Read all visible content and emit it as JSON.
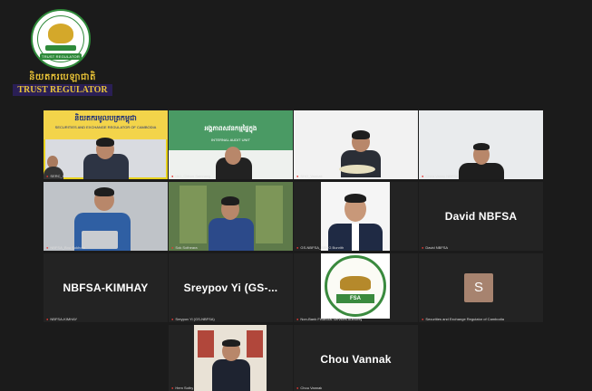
{
  "logo": {
    "khmer_text": "និយតករបេឡាជាតិ",
    "english_text": "TRUST REGULATOR",
    "ribbon_text": "TRUST REGULATOR"
  },
  "colors": {
    "background": "#1b1b1b",
    "active_speaker": "#e8d21d",
    "muted_mic": "#e53935",
    "brand_gold": "#e7c23a",
    "brand_green": "#2f8a3a"
  },
  "tiles": [
    {
      "name": "SERC_Ho Lisa",
      "banner_kh": "និយតករមូលបត្រកម្ពុជា",
      "banner_en": "SECURITIES AND EXCHANGE REGULATOR OF CAMBODIA",
      "active": true
    },
    {
      "name": "IAU_Chhun Samnang",
      "banner_kh": "អង្គភាពសវនកម្មផ្ទៃក្នុង",
      "banner_en": "INTERNAL AUDIT UNIT"
    },
    {
      "name": "SHO_Vannak"
    },
    {
      "name": "Chea Vanny NBFSA"
    },
    {
      "name": "NBFSA_Bou Sokhom"
    },
    {
      "name": "Sok Sotheara"
    },
    {
      "name": "GS-NBFSA_SENG Bunrith"
    },
    {
      "name": "David NBFSA",
      "display": "David NBFSA"
    },
    {
      "name": "NBFSA-KIMHAY",
      "display": "NBFSA-KIMHAY"
    },
    {
      "name": "Sreypov Yi (GS-NBFSA)",
      "display": "Sreypov Yi (GS-..."
    },
    {
      "name": "Non-Bank Financial Services Authority",
      "seal_text": "FSA"
    },
    {
      "name": "Securities and Exchange Regulator of Cambodia",
      "avatar": "S"
    },
    {
      "name": "Hem Sothy"
    },
    {
      "name": "Chou Vannak",
      "display": "Chou Vannak"
    }
  ]
}
